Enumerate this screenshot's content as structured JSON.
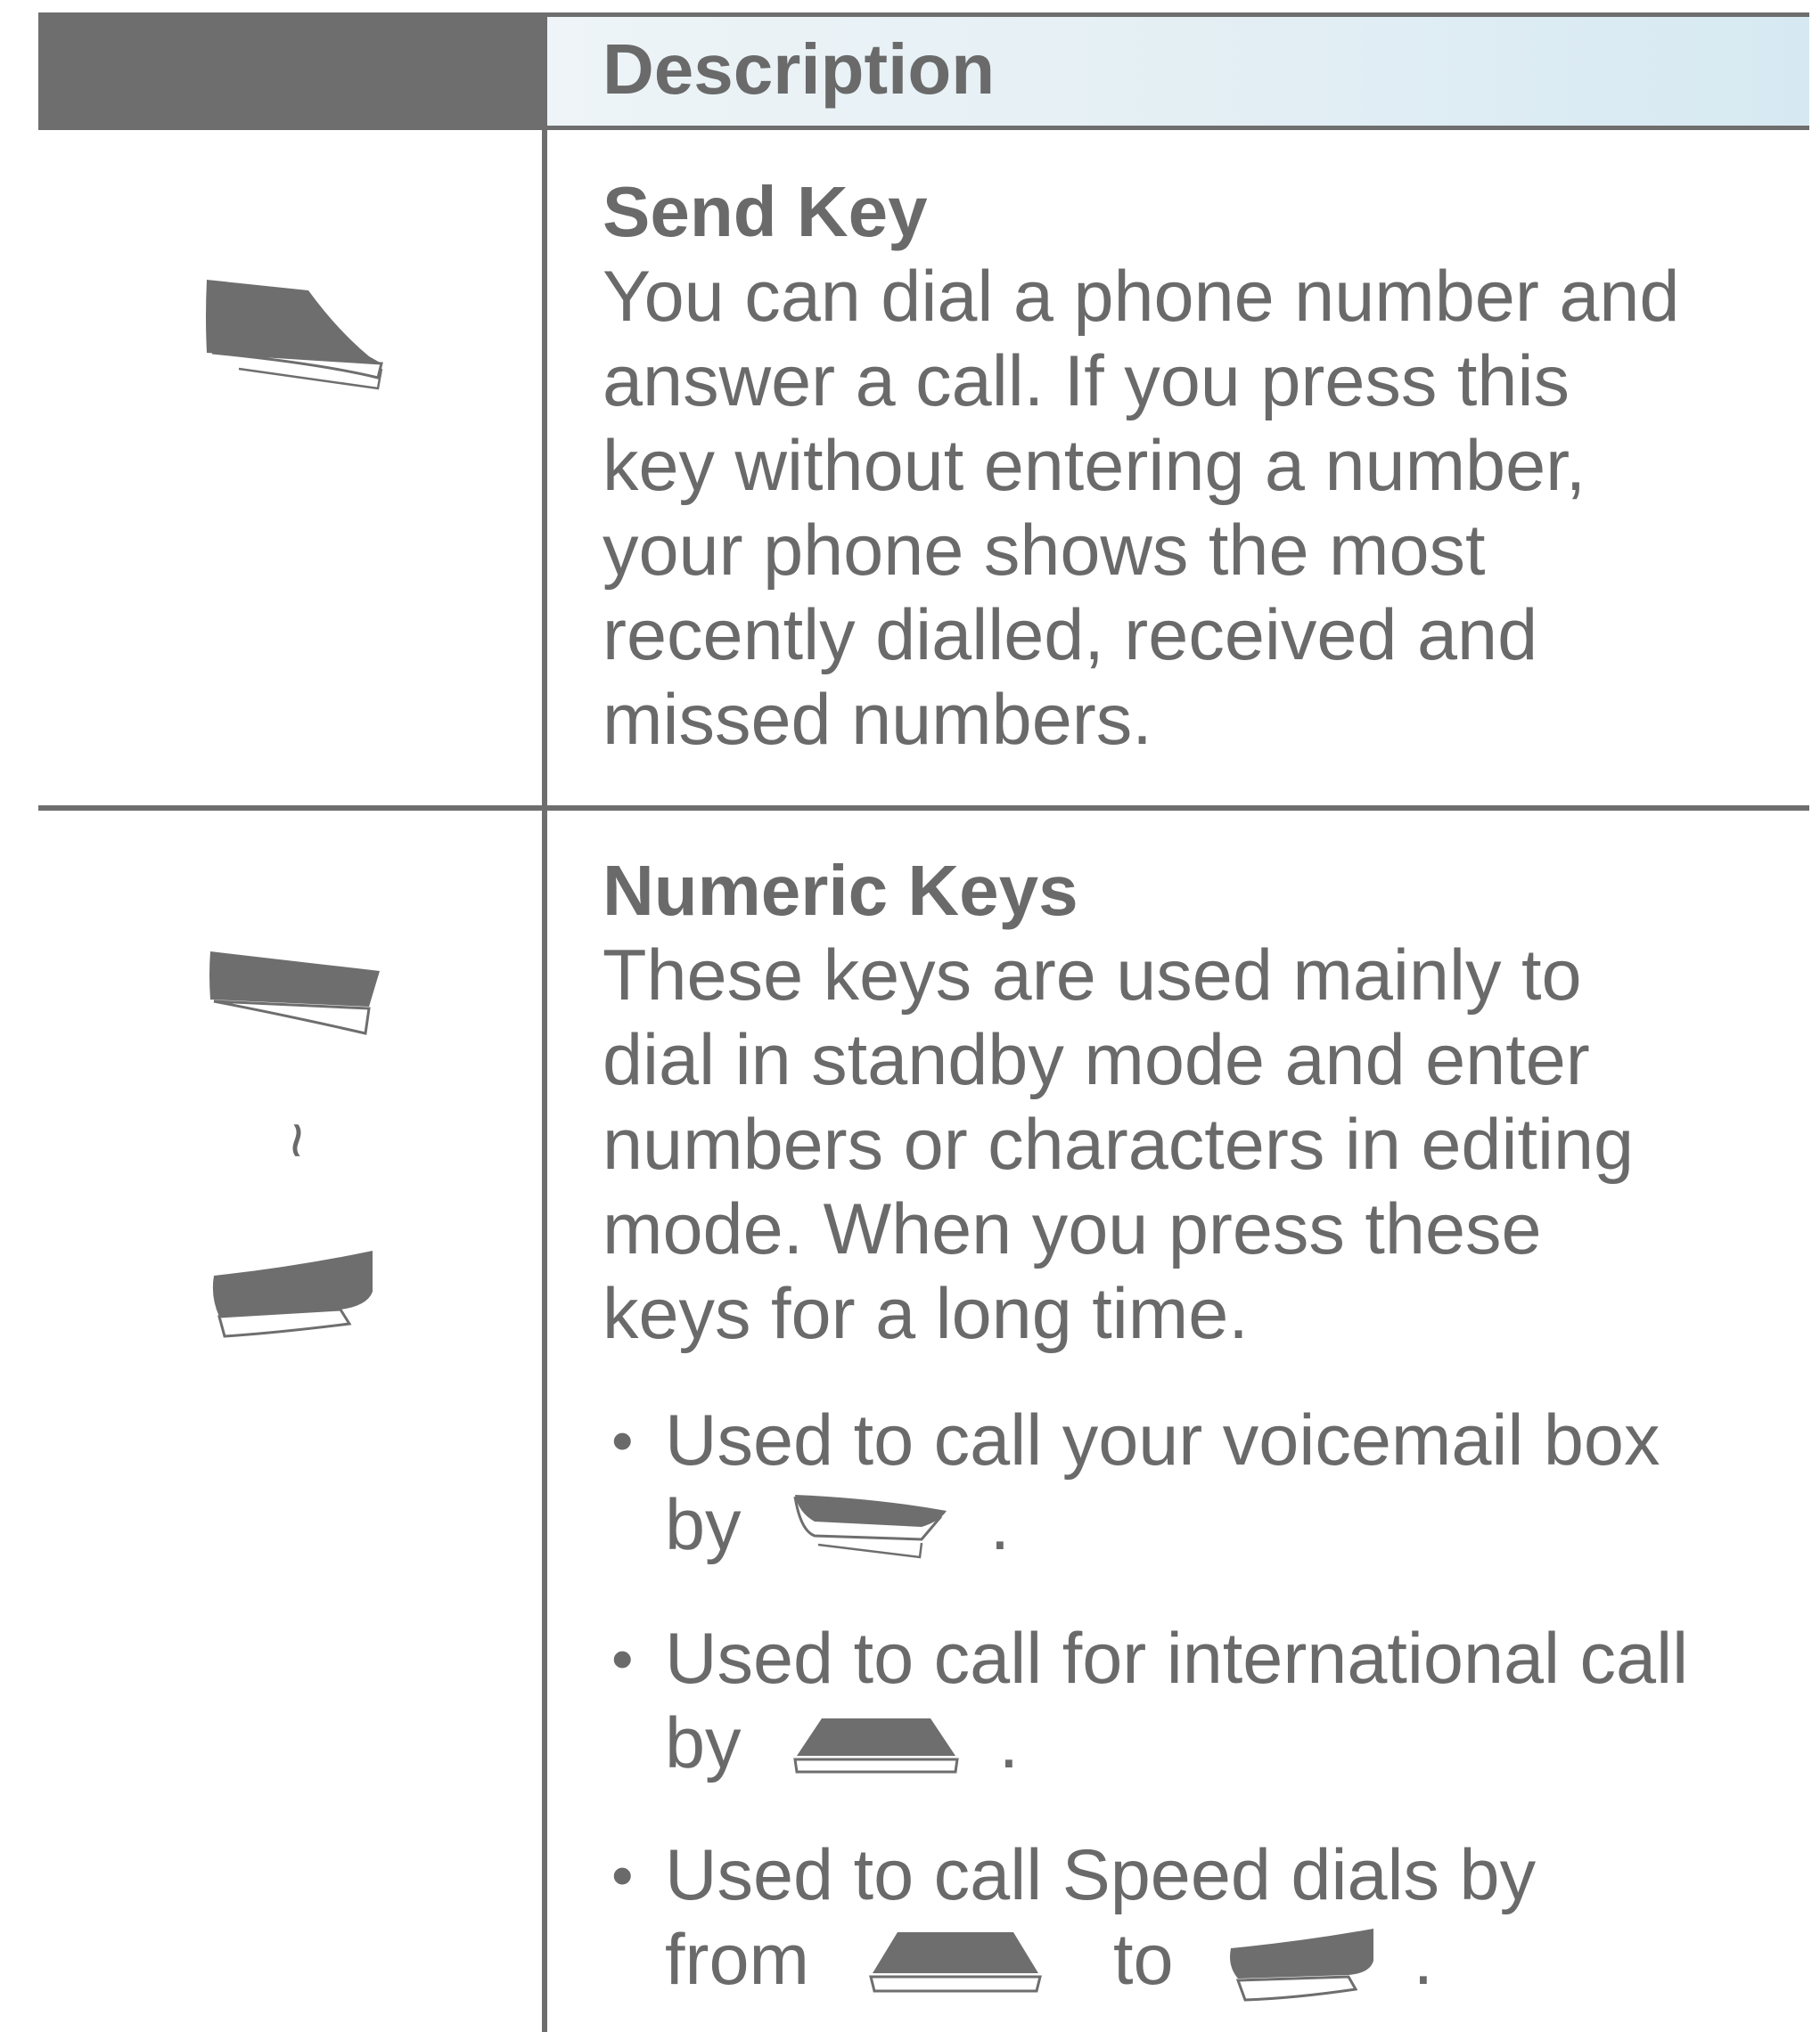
{
  "header": {
    "description_label": "Description"
  },
  "rows": [
    {
      "title": "Send Key",
      "body_lines": [
        "You can dial a phone number and",
        "answer a call. If you press this",
        "key without entering a number,",
        "your phone shows the most",
        "recently dialled, received and",
        "missed numbers."
      ],
      "icon": "send-key-icon"
    },
    {
      "title": "Numeric Keys",
      "body_lines": [
        "These keys are used mainly to",
        "dial in standby mode and enter",
        "numbers or characters in editing",
        "mode. When you press these",
        "keys for a long time."
      ],
      "range_separator": "~",
      "icons": [
        "numeric-key-first-icon",
        "numeric-key-last-icon"
      ],
      "bullets": [
        {
          "line1": "Used to call your voicemail box",
          "line2_prefix": "by",
          "line2_suffix": ".",
          "icon": "key-1-icon"
        },
        {
          "line1": "Used to call for international call",
          "line2_prefix": "by",
          "line2_suffix": ".",
          "icon": "key-0-icon"
        },
        {
          "line1": "Used to call Speed dials by",
          "line2_prefix": "from",
          "line2_mid": "to",
          "line2_suffix": ".",
          "icon": "key-2-icon",
          "icon_end": "key-9-icon"
        }
      ]
    }
  ],
  "colors": {
    "ink": "#6a6a6a",
    "rule": "#6e6e6e",
    "header_tint": "#e2eef4"
  }
}
